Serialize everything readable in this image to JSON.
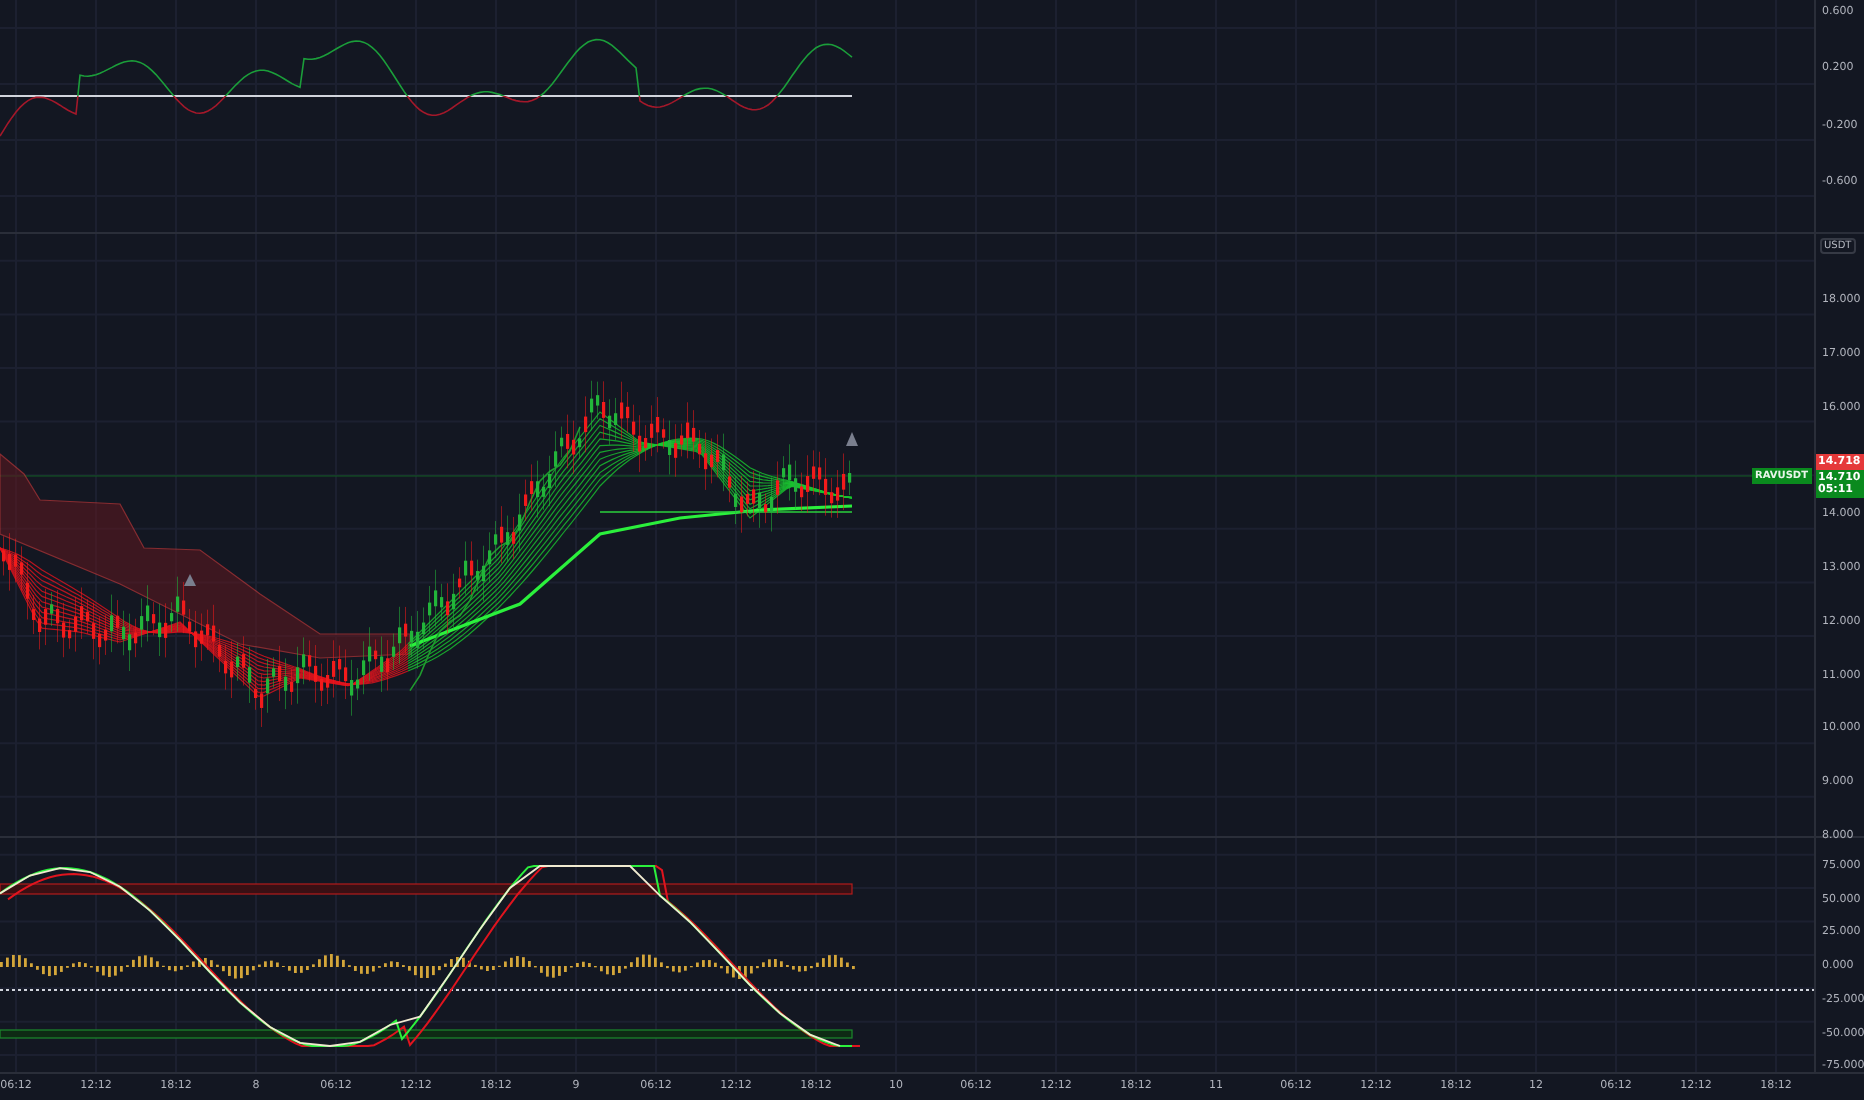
{
  "oscillator_axis": [
    "0.600",
    "0.200",
    "-0.200",
    "-0.600"
  ],
  "price_axis": {
    "currency": "USDT",
    "labels": [
      "18.000",
      "17.000",
      "16.000",
      "14.000",
      "13.000",
      "12.000",
      "11.000",
      "10.000",
      "9.000",
      "8.000"
    ]
  },
  "price_tags": {
    "symbol": "RAVUSDT",
    "high": "14.718",
    "last": "14.710",
    "countdown": "05:11"
  },
  "lower_axis": [
    "75.000",
    "50.000",
    "25.000",
    "0.000",
    "-25.000",
    "-50.000",
    "-75.000"
  ],
  "time_axis": [
    "06:12",
    "12:12",
    "18:12",
    "8",
    "06:12",
    "12:12",
    "18:12",
    "9",
    "06:12",
    "12:12",
    "18:12",
    "10",
    "06:12",
    "12:12",
    "18:12",
    "11",
    "06:12",
    "12:12",
    "18:12",
    "12",
    "06:12",
    "12:12",
    "18:12"
  ]
}
